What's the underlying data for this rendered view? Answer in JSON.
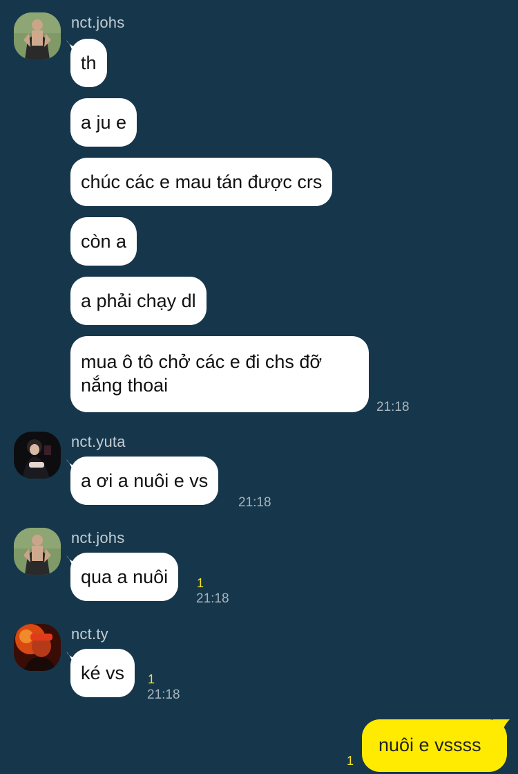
{
  "colors": {
    "background": "#16374b",
    "incoming_bubble": "#ffffff",
    "outgoing_bubble": "#ffeb02",
    "sender_name": "#c3ccd3",
    "timestamp": "#a8b4bd",
    "unread_count": "#f4e22a"
  },
  "messages": {
    "g1": {
      "sender": "nct.johs",
      "avatar": "profile-photo-man-tank-top",
      "m1": "th",
      "m2": "a ju e",
      "m3": "chúc các e mau tán được crs",
      "m4": "còn a",
      "m5": "a phải chạy dl",
      "m6": "mua ô tô chở các e đi chs đỡ nắng thoai",
      "time": "21:18"
    },
    "g2": {
      "sender": "nct.yuta",
      "avatar": "profile-photo-dark-portrait",
      "m1": "a ơi a nuôi e vs",
      "time": "21:18"
    },
    "g3": {
      "sender": "nct.johs",
      "avatar": "profile-photo-man-tank-top",
      "m1": "qua a nuôi",
      "unread": "1",
      "time": "21:18"
    },
    "g4": {
      "sender": "nct.ty",
      "avatar": "profile-photo-red-light",
      "m1": "ké vs",
      "unread": "1",
      "time": "21:18"
    },
    "mine": {
      "m1": "nuôi e vssss",
      "unread": "1"
    }
  }
}
